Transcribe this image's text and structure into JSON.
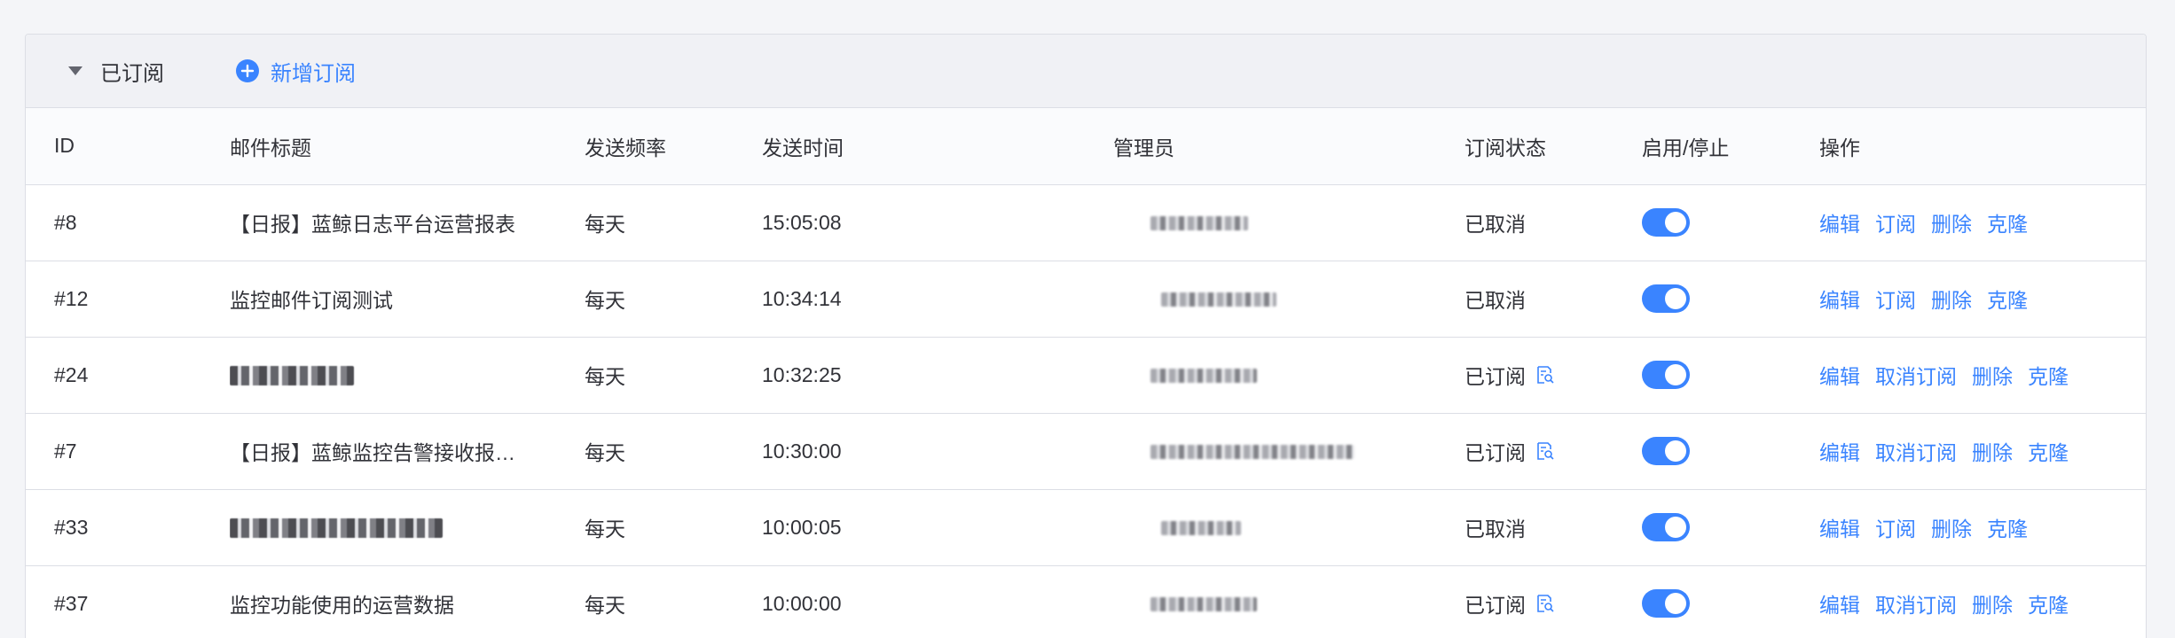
{
  "panel": {
    "section_title": "已订阅",
    "add_label": "新增订阅"
  },
  "columns": {
    "id": "ID",
    "title": "邮件标题",
    "frequency": "发送频率",
    "time": "发送时间",
    "admin": "管理员",
    "status": "订阅状态",
    "toggle": "启用/停止",
    "actions": "操作"
  },
  "rows": [
    {
      "id": "#8",
      "title": "【日报】蓝鲸日志平台运营报表",
      "title_redacted": false,
      "frequency": "每天",
      "time": "15:05:08",
      "status": "已取消",
      "enabled": true,
      "actions": [
        "编辑",
        "订阅",
        "删除",
        "克隆"
      ]
    },
    {
      "id": "#12",
      "title": "监控邮件订阅测试",
      "title_redacted": false,
      "frequency": "每天",
      "time": "10:34:14",
      "status": "已取消",
      "enabled": true,
      "actions": [
        "编辑",
        "订阅",
        "删除",
        "克隆"
      ]
    },
    {
      "id": "#24",
      "title": "",
      "title_redacted": true,
      "frequency": "每天",
      "time": "10:32:25",
      "status": "已订阅",
      "enabled": true,
      "actions": [
        "编辑",
        "取消订阅",
        "删除",
        "克隆"
      ]
    },
    {
      "id": "#7",
      "title": "【日报】蓝鲸监控告警接收报…",
      "title_redacted": false,
      "frequency": "每天",
      "time": "10:30:00",
      "status": "已订阅",
      "enabled": true,
      "actions": [
        "编辑",
        "取消订阅",
        "删除",
        "克隆"
      ]
    },
    {
      "id": "#33",
      "title": "",
      "title_redacted": true,
      "frequency": "每天",
      "time": "10:00:05",
      "status": "已取消",
      "enabled": true,
      "actions": [
        "编辑",
        "订阅",
        "删除",
        "克隆"
      ]
    },
    {
      "id": "#37",
      "title": "监控功能使用的运营数据",
      "title_redacted": false,
      "frequency": "每天",
      "time": "10:00:00",
      "status": "已订阅",
      "enabled": true,
      "actions": [
        "编辑",
        "取消订阅",
        "删除",
        "克隆"
      ]
    }
  ],
  "icons": {
    "collapse": "caret-down-icon",
    "add": "plus-circle-icon",
    "detail": "document-search-icon"
  },
  "colors": {
    "accent": "#3a84ff",
    "header_bg": "#f0f1f5",
    "border": "#dcdee5",
    "text": "#313238"
  }
}
